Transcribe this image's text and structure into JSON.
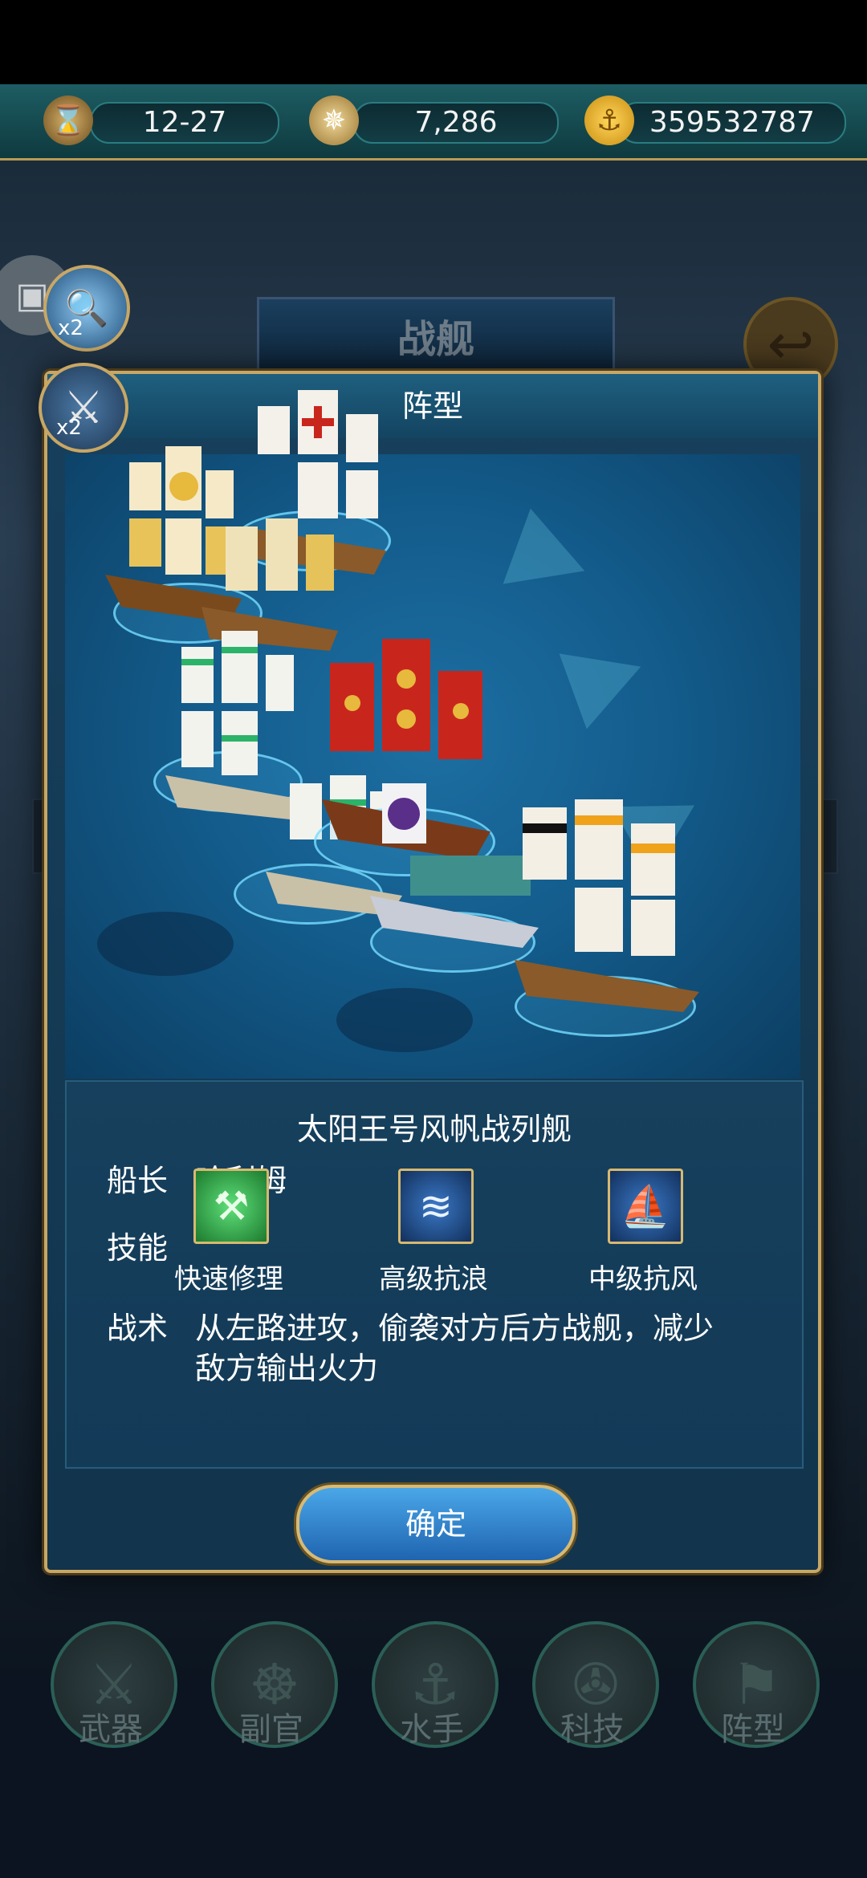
{
  "resources": {
    "date": "12-27",
    "compass_value": "7,286",
    "gold": "359532787",
    "date_icon": "hourglass-icon",
    "compass_icon": "compass-icon",
    "gold_icon": "anchor-coin-icon"
  },
  "background": {
    "title": "战舰",
    "magnifier_multiplier": "x2",
    "swords_multiplier": "x2"
  },
  "dialog": {
    "title": "阵型",
    "ship_name": "太阳王号风帆战列舰",
    "captain_label": "船长",
    "captain_name": "哈利姆",
    "skills_label": "技能",
    "skills": [
      {
        "name": "快速修理",
        "icon": "repair-tools-icon"
      },
      {
        "name": "高级抗浪",
        "icon": "wave-icon"
      },
      {
        "name": "中级抗风",
        "icon": "sail-wind-icon"
      }
    ],
    "tactic_label": "战术",
    "tactic_line1": "从左路进攻，偷袭对方后方战舰，减少",
    "tactic_line2": "敌方输出火力",
    "confirm_label": "确定"
  },
  "nav": {
    "items": [
      {
        "label": "武器",
        "icon": "weapon-icon"
      },
      {
        "label": "副官",
        "icon": "helm-wheel-icon"
      },
      {
        "label": "水手",
        "icon": "hook-icon"
      },
      {
        "label": "科技",
        "icon": "compass-tech-icon"
      },
      {
        "label": "阵型",
        "icon": "flag-icon"
      }
    ]
  },
  "colors": {
    "gold_border": "#c8a765",
    "ocean": "#135c8c",
    "confirm_button": "#1f64b0"
  }
}
